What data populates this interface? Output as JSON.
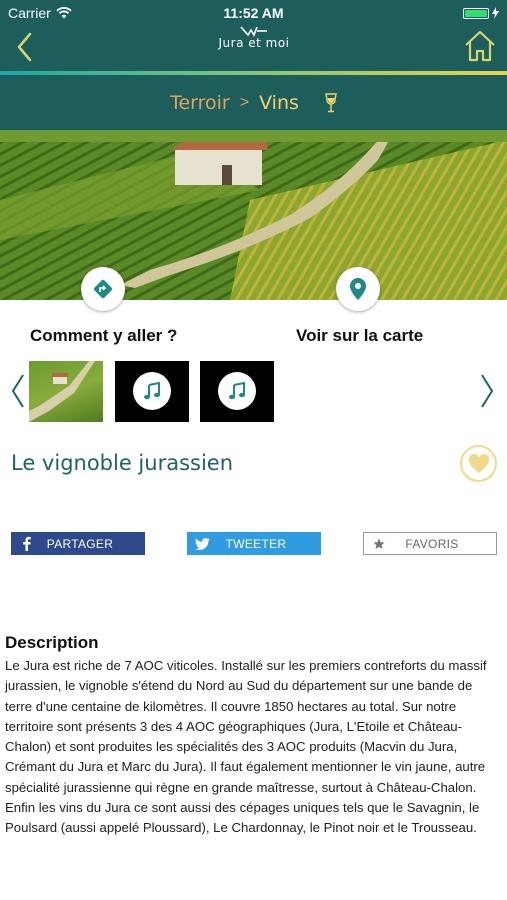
{
  "status_bar": {
    "carrier": "Carrier",
    "time": "11:52 AM"
  },
  "header": {
    "logo_text": "Jura et moi"
  },
  "breadcrumb": {
    "parent": "Terroir",
    "separator": ">",
    "current": "Vins",
    "icon": "wine-glass-icon"
  },
  "actions": {
    "directions_label": "Comment y aller ?",
    "map_label": "Voir sur la carte"
  },
  "gallery": {
    "items": [
      "image",
      "audio",
      "audio"
    ]
  },
  "article": {
    "title": "Le vignoble jurassien"
  },
  "share": {
    "facebook": "PARTAGER",
    "twitter": "TWEETER",
    "favorites": "FAVORIS"
  },
  "description": {
    "heading": "Description",
    "text": "Le Jura est riche de 7 AOC viticoles. Installé sur les premiers contreforts du massif jurassien, le vignoble s'étend du Nord au Sud du département sur une bande de terre d'une centaine de kilomètres. Il couvre 1850 hectares au total. Sur notre territoire sont présents 3 des 4 AOC géographiques (Jura, L'Etoile et Château-Chalon) et sont produites les spécialités des 3 AOC produits (Macvin du Jura, Crémant du Jura et Marc du Jura). Il faut également mentionner le vin jaune, autre spécialité jurassienne qui règne en grande maîtresse, surtout à Château-Chalon. Enfin les vins du Jura ce sont aussi des cépages uniques tels que le Savagnin, le Poulsard (aussi appelé Ploussard), Le Chardonnay, le Pinot noir et le Trousseau."
  },
  "colors": {
    "header": "#1d5e5d",
    "accent": "#e0a45a",
    "title": "#1d6564"
  }
}
